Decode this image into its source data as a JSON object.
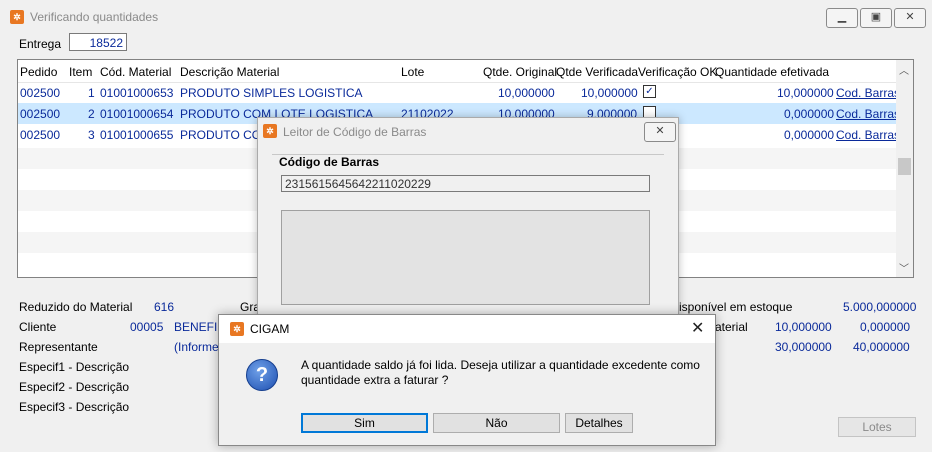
{
  "window": {
    "title": "Verificando quantidades"
  },
  "entrega": {
    "label": "Entrega",
    "value": "18522"
  },
  "grid": {
    "headers": [
      "Pedido",
      "Item",
      "Cód. Material",
      "Descrição Material",
      "Lote",
      "Qtde. Original",
      "Qtde Verificada",
      "Verificação OK",
      "Quantidade efetivada"
    ],
    "rows": [
      {
        "pedido": "002500",
        "item": "1",
        "cod": "01001000653",
        "desc": "PRODUTO SIMPLES LOGISTICA",
        "lote": "",
        "orig": "10,000000",
        "verif": "10,000000",
        "ok": true,
        "efet": "10,000000",
        "link": "Cod. Barras"
      },
      {
        "pedido": "002500",
        "item": "2",
        "cod": "01001000654",
        "desc": "PRODUTO COM LOTE LOGISTICA",
        "lote": "21102022",
        "orig": "10,000000",
        "verif": "9,000000",
        "ok": false,
        "efet": "0,000000",
        "link": "Cod. Barras"
      },
      {
        "pedido": "002500",
        "item": "3",
        "cod": "01001000655",
        "desc": "PRODUTO COM",
        "lote": "",
        "orig": "",
        "verif": "",
        "ok": false,
        "efet": "0,000000",
        "link": "Cod. Barras"
      }
    ]
  },
  "details": {
    "reduzido_label": "Reduzido do Material",
    "reduzido_value": "616",
    "gra_partial": "Gra",
    "cliente_label": "Cliente",
    "cliente_code": "00005",
    "cliente_name": "BENEFICI",
    "representante_label": "Representante",
    "representante_value": "(Informe",
    "espec1": "Especif1 - Descrição",
    "espec2": "Especif2 - Descrição",
    "espec3": "Especif3 - Descrição",
    "estoque_label": "isponível em estoque",
    "estoque_value": "5.000,000000",
    "material_label": "aterial",
    "material_v1": "10,000000",
    "material_v2": "0,000000",
    "row3_v1": "30,000000",
    "row3_v2": "40,000000",
    "lotes_button": "Lotes"
  },
  "barcode_dialog": {
    "title": "Leitor de Código de Barras",
    "group_label": "Código de Barras",
    "value": "2315615645642211020229"
  },
  "confirm_dialog": {
    "title": "CIGAM",
    "message_line1": "A quantidade saldo já foi lida. Deseja utilizar a quantidade excedente como",
    "message_line2": "quantidade extra a faturar ?",
    "btn_yes": "Sim",
    "btn_no": "Não",
    "btn_details": "Detalhes"
  },
  "colors": {
    "selected_row": "#cce8ff",
    "link": "#0a2a9a",
    "icon": "#e87722"
  }
}
